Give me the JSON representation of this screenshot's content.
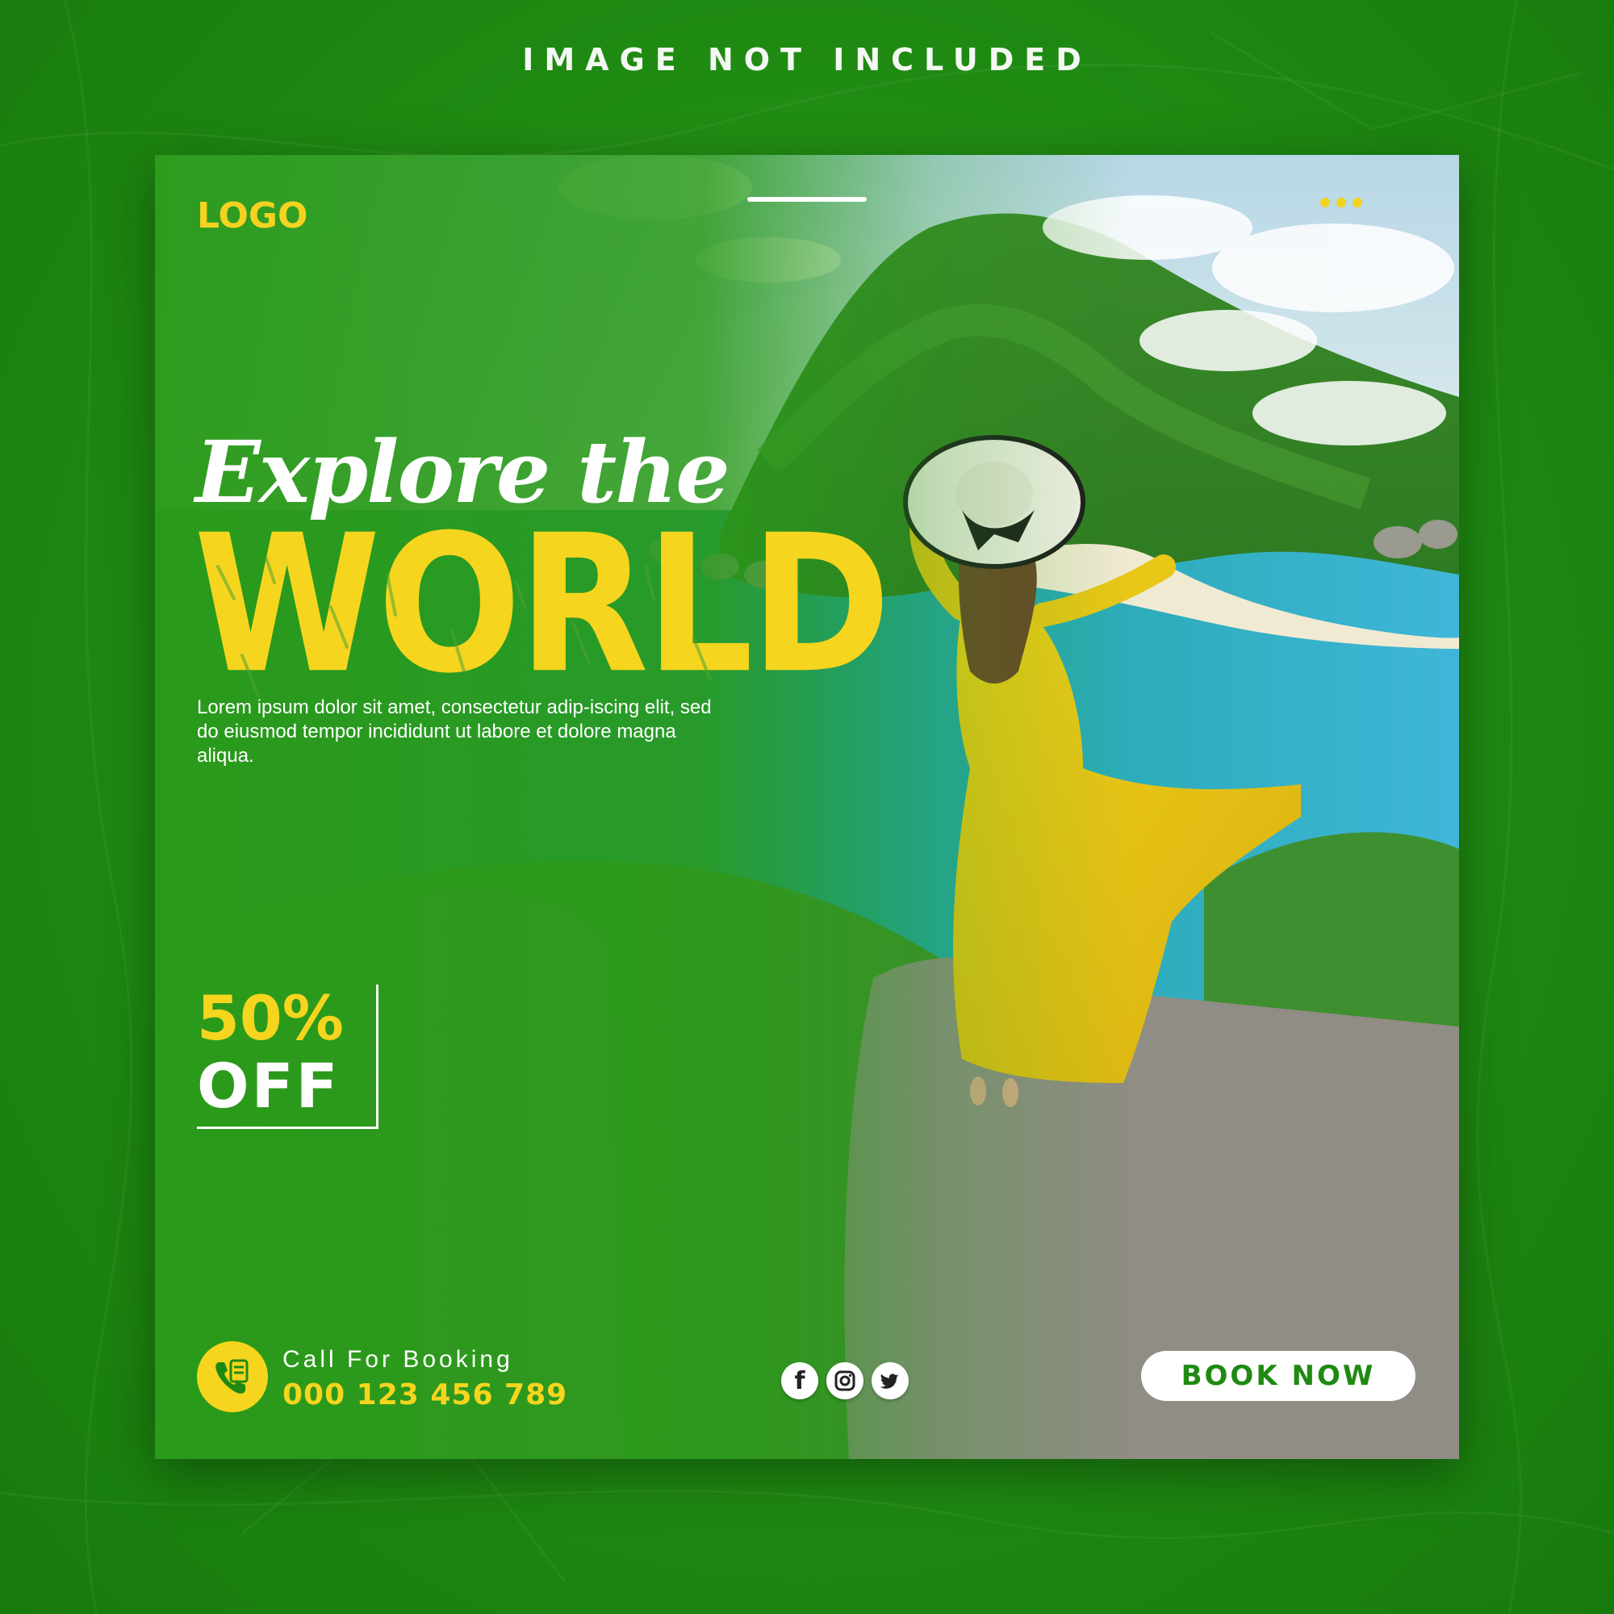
{
  "header_note": "IMAGE NOT INCLUDED",
  "card": {
    "logo": "LOGO",
    "title_script": "Explore the",
    "title_main": "WORLD",
    "description": "Lorem ipsum dolor sit amet, consectetur adip-iscing elit, sed do eiusmod tempor incididunt ut labore et dolore magna aliqua.",
    "discount": {
      "percent": "50%",
      "label": "OFF"
    },
    "booking": {
      "label": "Call For Booking",
      "phone": "000 123 456 789"
    },
    "socials": [
      {
        "icon": "facebook-icon",
        "glyph": "f"
      },
      {
        "icon": "instagram-icon"
      },
      {
        "icon": "twitter-icon"
      }
    ],
    "cta_label": "BOOK NOW"
  },
  "colors": {
    "background_green": "#1f8a12",
    "accent_yellow": "#f6d51e",
    "text_white": "#ffffff"
  }
}
